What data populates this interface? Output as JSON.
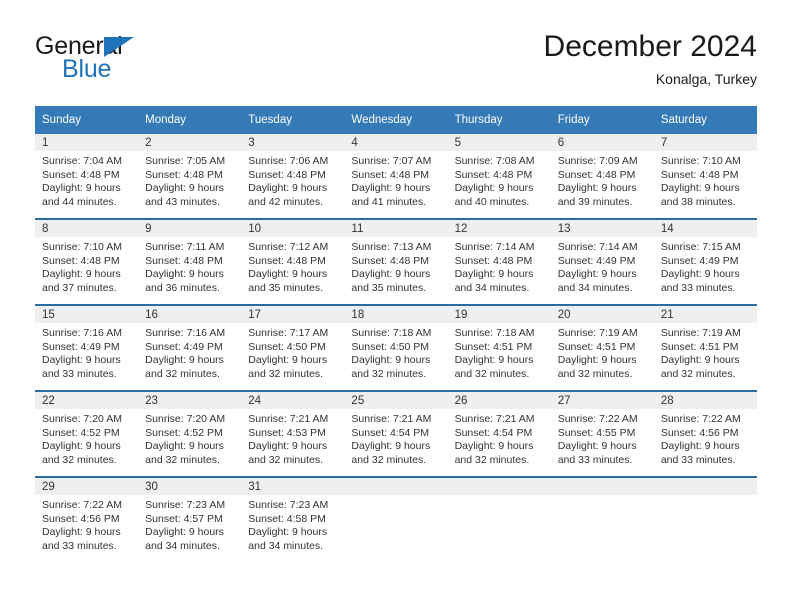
{
  "brand": {
    "name_part1": "General",
    "name_part2": "Blue",
    "triangle_color": "#1f73b8"
  },
  "header": {
    "title": "December 2024",
    "subtitle": "Konalga, Turkey"
  },
  "theme": {
    "header_bg": "#337ab7",
    "row_divider": "#2b6ca3",
    "daynum_bg": "#efefef",
    "text": "#333333"
  },
  "weekdays": [
    "Sunday",
    "Monday",
    "Tuesday",
    "Wednesday",
    "Thursday",
    "Friday",
    "Saturday"
  ],
  "weeks": [
    [
      {
        "day": "1",
        "sunrise": "Sunrise: 7:04 AM",
        "sunset": "Sunset: 4:48 PM",
        "daylight1": "Daylight: 9 hours",
        "daylight2": "and 44 minutes."
      },
      {
        "day": "2",
        "sunrise": "Sunrise: 7:05 AM",
        "sunset": "Sunset: 4:48 PM",
        "daylight1": "Daylight: 9 hours",
        "daylight2": "and 43 minutes."
      },
      {
        "day": "3",
        "sunrise": "Sunrise: 7:06 AM",
        "sunset": "Sunset: 4:48 PM",
        "daylight1": "Daylight: 9 hours",
        "daylight2": "and 42 minutes."
      },
      {
        "day": "4",
        "sunrise": "Sunrise: 7:07 AM",
        "sunset": "Sunset: 4:48 PM",
        "daylight1": "Daylight: 9 hours",
        "daylight2": "and 41 minutes."
      },
      {
        "day": "5",
        "sunrise": "Sunrise: 7:08 AM",
        "sunset": "Sunset: 4:48 PM",
        "daylight1": "Daylight: 9 hours",
        "daylight2": "and 40 minutes."
      },
      {
        "day": "6",
        "sunrise": "Sunrise: 7:09 AM",
        "sunset": "Sunset: 4:48 PM",
        "daylight1": "Daylight: 9 hours",
        "daylight2": "and 39 minutes."
      },
      {
        "day": "7",
        "sunrise": "Sunrise: 7:10 AM",
        "sunset": "Sunset: 4:48 PM",
        "daylight1": "Daylight: 9 hours",
        "daylight2": "and 38 minutes."
      }
    ],
    [
      {
        "day": "8",
        "sunrise": "Sunrise: 7:10 AM",
        "sunset": "Sunset: 4:48 PM",
        "daylight1": "Daylight: 9 hours",
        "daylight2": "and 37 minutes."
      },
      {
        "day": "9",
        "sunrise": "Sunrise: 7:11 AM",
        "sunset": "Sunset: 4:48 PM",
        "daylight1": "Daylight: 9 hours",
        "daylight2": "and 36 minutes."
      },
      {
        "day": "10",
        "sunrise": "Sunrise: 7:12 AM",
        "sunset": "Sunset: 4:48 PM",
        "daylight1": "Daylight: 9 hours",
        "daylight2": "and 35 minutes."
      },
      {
        "day": "11",
        "sunrise": "Sunrise: 7:13 AM",
        "sunset": "Sunset: 4:48 PM",
        "daylight1": "Daylight: 9 hours",
        "daylight2": "and 35 minutes."
      },
      {
        "day": "12",
        "sunrise": "Sunrise: 7:14 AM",
        "sunset": "Sunset: 4:48 PM",
        "daylight1": "Daylight: 9 hours",
        "daylight2": "and 34 minutes."
      },
      {
        "day": "13",
        "sunrise": "Sunrise: 7:14 AM",
        "sunset": "Sunset: 4:49 PM",
        "daylight1": "Daylight: 9 hours",
        "daylight2": "and 34 minutes."
      },
      {
        "day": "14",
        "sunrise": "Sunrise: 7:15 AM",
        "sunset": "Sunset: 4:49 PM",
        "daylight1": "Daylight: 9 hours",
        "daylight2": "and 33 minutes."
      }
    ],
    [
      {
        "day": "15",
        "sunrise": "Sunrise: 7:16 AM",
        "sunset": "Sunset: 4:49 PM",
        "daylight1": "Daylight: 9 hours",
        "daylight2": "and 33 minutes."
      },
      {
        "day": "16",
        "sunrise": "Sunrise: 7:16 AM",
        "sunset": "Sunset: 4:49 PM",
        "daylight1": "Daylight: 9 hours",
        "daylight2": "and 32 minutes."
      },
      {
        "day": "17",
        "sunrise": "Sunrise: 7:17 AM",
        "sunset": "Sunset: 4:50 PM",
        "daylight1": "Daylight: 9 hours",
        "daylight2": "and 32 minutes."
      },
      {
        "day": "18",
        "sunrise": "Sunrise: 7:18 AM",
        "sunset": "Sunset: 4:50 PM",
        "daylight1": "Daylight: 9 hours",
        "daylight2": "and 32 minutes."
      },
      {
        "day": "19",
        "sunrise": "Sunrise: 7:18 AM",
        "sunset": "Sunset: 4:51 PM",
        "daylight1": "Daylight: 9 hours",
        "daylight2": "and 32 minutes."
      },
      {
        "day": "20",
        "sunrise": "Sunrise: 7:19 AM",
        "sunset": "Sunset: 4:51 PM",
        "daylight1": "Daylight: 9 hours",
        "daylight2": "and 32 minutes."
      },
      {
        "day": "21",
        "sunrise": "Sunrise: 7:19 AM",
        "sunset": "Sunset: 4:51 PM",
        "daylight1": "Daylight: 9 hours",
        "daylight2": "and 32 minutes."
      }
    ],
    [
      {
        "day": "22",
        "sunrise": "Sunrise: 7:20 AM",
        "sunset": "Sunset: 4:52 PM",
        "daylight1": "Daylight: 9 hours",
        "daylight2": "and 32 minutes."
      },
      {
        "day": "23",
        "sunrise": "Sunrise: 7:20 AM",
        "sunset": "Sunset: 4:52 PM",
        "daylight1": "Daylight: 9 hours",
        "daylight2": "and 32 minutes."
      },
      {
        "day": "24",
        "sunrise": "Sunrise: 7:21 AM",
        "sunset": "Sunset: 4:53 PM",
        "daylight1": "Daylight: 9 hours",
        "daylight2": "and 32 minutes."
      },
      {
        "day": "25",
        "sunrise": "Sunrise: 7:21 AM",
        "sunset": "Sunset: 4:54 PM",
        "daylight1": "Daylight: 9 hours",
        "daylight2": "and 32 minutes."
      },
      {
        "day": "26",
        "sunrise": "Sunrise: 7:21 AM",
        "sunset": "Sunset: 4:54 PM",
        "daylight1": "Daylight: 9 hours",
        "daylight2": "and 32 minutes."
      },
      {
        "day": "27",
        "sunrise": "Sunrise: 7:22 AM",
        "sunset": "Sunset: 4:55 PM",
        "daylight1": "Daylight: 9 hours",
        "daylight2": "and 33 minutes."
      },
      {
        "day": "28",
        "sunrise": "Sunrise: 7:22 AM",
        "sunset": "Sunset: 4:56 PM",
        "daylight1": "Daylight: 9 hours",
        "daylight2": "and 33 minutes."
      }
    ],
    [
      {
        "day": "29",
        "sunrise": "Sunrise: 7:22 AM",
        "sunset": "Sunset: 4:56 PM",
        "daylight1": "Daylight: 9 hours",
        "daylight2": "and 33 minutes."
      },
      {
        "day": "30",
        "sunrise": "Sunrise: 7:23 AM",
        "sunset": "Sunset: 4:57 PM",
        "daylight1": "Daylight: 9 hours",
        "daylight2": "and 34 minutes."
      },
      {
        "day": "31",
        "sunrise": "Sunrise: 7:23 AM",
        "sunset": "Sunset: 4:58 PM",
        "daylight1": "Daylight: 9 hours",
        "daylight2": "and 34 minutes."
      },
      {
        "day": "",
        "sunrise": "",
        "sunset": "",
        "daylight1": "",
        "daylight2": ""
      },
      {
        "day": "",
        "sunrise": "",
        "sunset": "",
        "daylight1": "",
        "daylight2": ""
      },
      {
        "day": "",
        "sunrise": "",
        "sunset": "",
        "daylight1": "",
        "daylight2": ""
      },
      {
        "day": "",
        "sunrise": "",
        "sunset": "",
        "daylight1": "",
        "daylight2": ""
      }
    ]
  ]
}
